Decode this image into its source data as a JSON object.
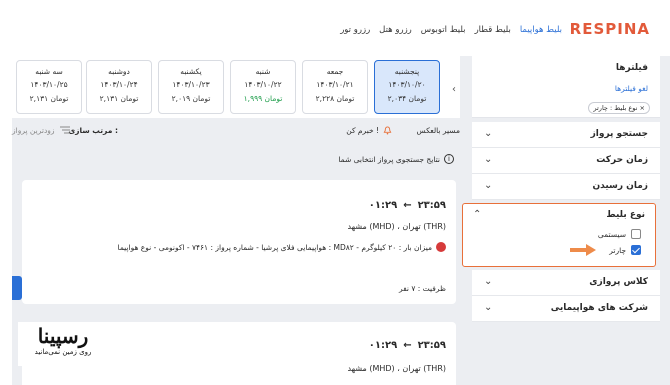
{
  "header": {
    "brand": "RESPINA",
    "nav": [
      "بلیط هواپیما",
      "بلیط قطار",
      "بلیط اتوبوس",
      "رزرو هتل",
      "رزرو تور"
    ],
    "active_nav_index": 0,
    "colors": {
      "brand": "#e25a3a",
      "accent": "#2a6fd6",
      "highlight_border": "#e8703a"
    }
  },
  "sidebar": {
    "filters_title": "فیلترها",
    "clear_filters": "لغو فیلترها",
    "active_chip": "نوع بلیط : چارتر",
    "chip_close": "×",
    "rows": [
      {
        "label": "جستجو پرواز"
      },
      {
        "label": "زمان حرکت"
      },
      {
        "label": "زمان رسیدن"
      },
      {
        "label": "کلاس پروازی"
      },
      {
        "label": "شرکت های هواپیمایی"
      }
    ],
    "ticket_type": {
      "label": "نوع بلیط",
      "options": [
        {
          "label": "سیستمی",
          "checked": false
        },
        {
          "label": "چارتر",
          "checked": true
        }
      ]
    }
  },
  "date_strip": {
    "cards": [
      {
        "day": "پنجشنبه",
        "date": "۱۴۰۳/۱۰/۲۰",
        "price": "۲,۰۳۴ تومان",
        "selected": true,
        "green": false
      },
      {
        "day": "جمعه",
        "date": "۱۴۰۳/۱۰/۲۱",
        "price": "۲,۲۲۸ تومان",
        "selected": false,
        "green": false
      },
      {
        "day": "شنبه",
        "date": "۱۴۰۳/۱۰/۲۲",
        "price": "۱,۹۹۹ تومان",
        "selected": false,
        "green": true
      },
      {
        "day": "یکشنبه",
        "date": "۱۴۰۳/۱۰/۲۳",
        "price": "۲,۰۱۹ تومان",
        "selected": false,
        "green": false
      },
      {
        "day": "دوشنبه",
        "date": "۱۴۰۳/۱۰/۲۴",
        "price": "۲,۱۳۱ تومان",
        "selected": false,
        "green": false
      },
      {
        "day": "سه شنبه",
        "date": "۱۴۰۳/۱۰/۲۵",
        "price": "۲,۱۳۱ تومان",
        "selected": false,
        "green": false
      }
    ]
  },
  "sortbar": {
    "direct": "مسیر بالعکس",
    "alert": "خبرم کن !",
    "sort_label": "مرتب سازی :",
    "sort_value": "زودترین پرواز",
    "result_note": "نتایج جستجوی پرواز انتخابی شما",
    "info_glyph": "i"
  },
  "flights": [
    {
      "depart": "۲۳:۵۹",
      "arrow": "←",
      "arrive": "۰۱:۲۹",
      "route": "مشهد (MHD) ، تهران (THR)",
      "details": "هواپیمایی فلای پرشیا - شماره پرواز : ۷۴۶۱ - اکونومی - نوع هواپیما : MD۸۲ - میزان بار : ۲۰ کیلوگرم",
      "capacity": "ظرفیت : ۷ نفر"
    },
    {
      "depart": "۲۳:۵۹",
      "arrow": "←",
      "arrive": "۰۱:۲۹",
      "route": "مشهد (MHD) ، تهران (THR)"
    }
  ],
  "watermark": {
    "main": "رسپینا",
    "sub": "روی زمین نمی‌مانید"
  }
}
